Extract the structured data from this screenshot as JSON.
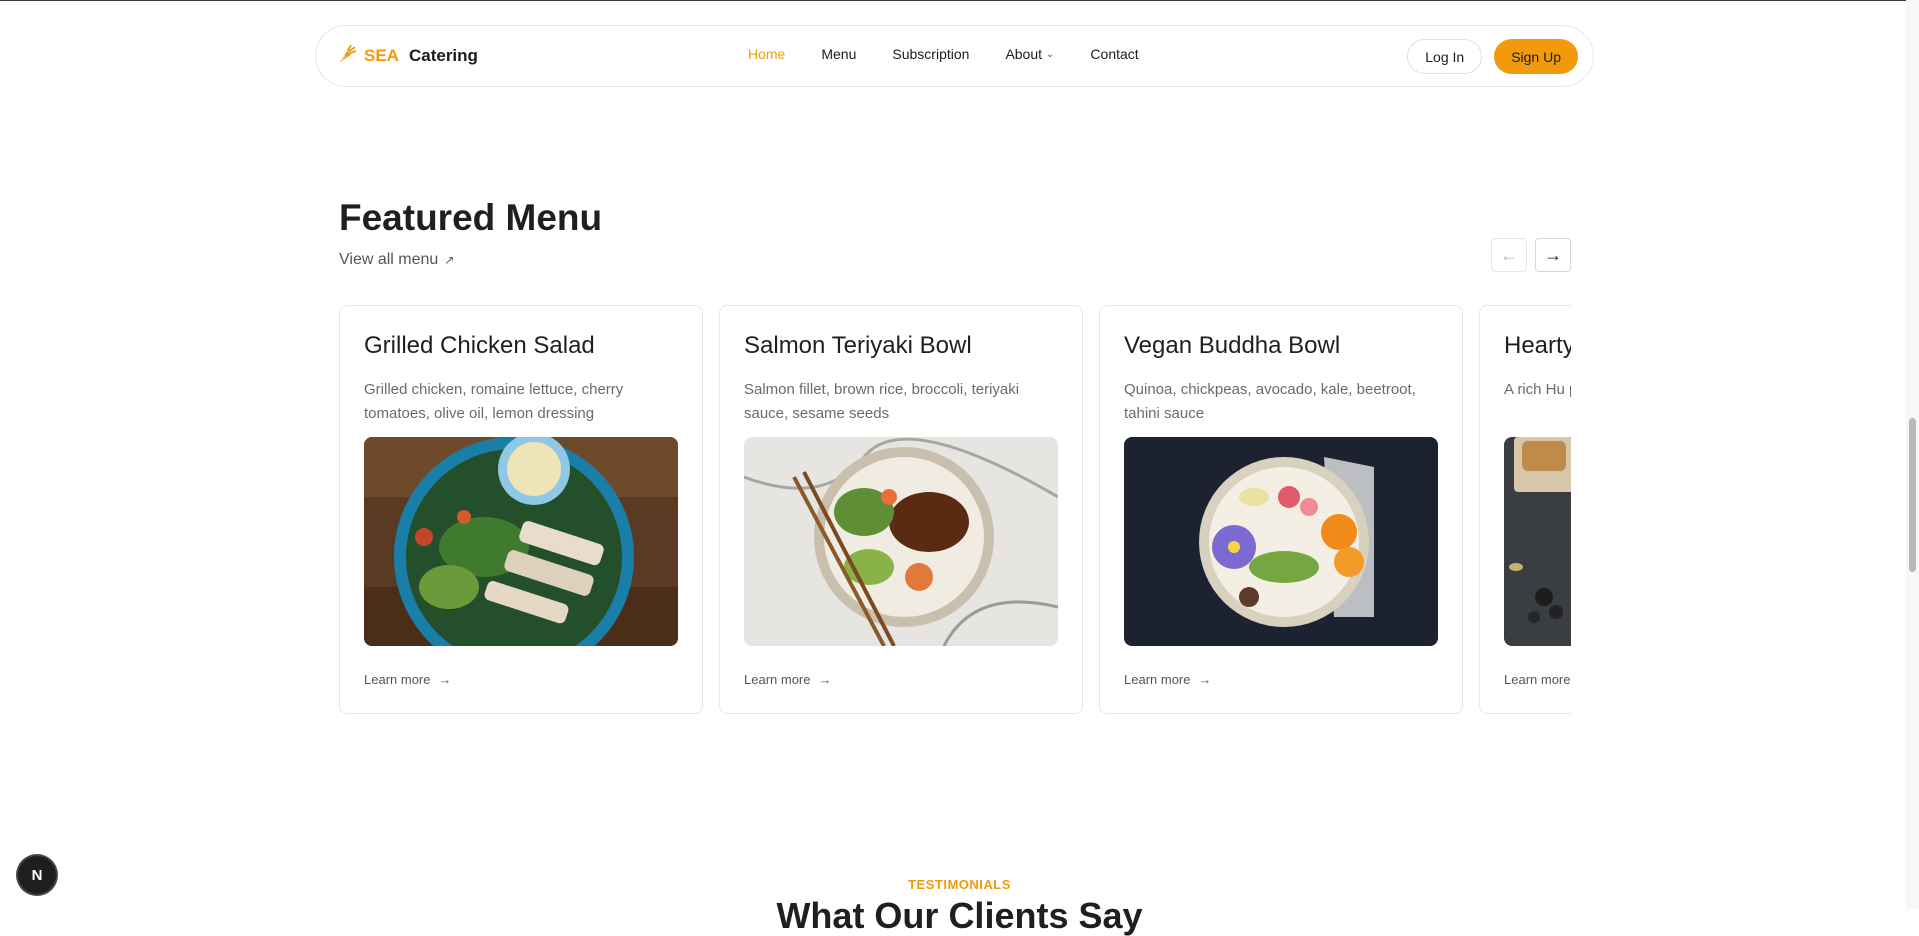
{
  "brand": {
    "accent": "SEA",
    "name": "Catering",
    "accent_color": "#f29a0b"
  },
  "nav": {
    "items": [
      {
        "label": "Home",
        "active": true
      },
      {
        "label": "Menu"
      },
      {
        "label": "Subscription"
      },
      {
        "label": "About",
        "dropdown": true
      },
      {
        "label": "Contact"
      }
    ],
    "login_label": "Log In",
    "signup_label": "Sign Up"
  },
  "featured": {
    "title": "Featured Menu",
    "view_all_label": "View all menu",
    "cards": [
      {
        "title": "Grilled Chicken Salad",
        "description": "Grilled chicken, romaine lettuce, cherry tomatoes, olive oil, lemon dressing",
        "link_label": "Learn more",
        "image_icon": "chicken-salad-photo"
      },
      {
        "title": "Salmon Teriyaki Bowl",
        "description": "Salmon fillet, brown rice, broccoli, teriyaki sauce, sesame seeds",
        "link_label": "Learn more",
        "image_icon": "salmon-bowl-photo"
      },
      {
        "title": "Vegan Buddha Bowl",
        "description": "Quinoa, chickpeas, avocado, kale, beetroot, tahini sauce",
        "link_label": "Learn more",
        "image_icon": "buddha-bowl-photo"
      },
      {
        "title": "Hearty",
        "description": "A rich Hu paprika, p",
        "link_label": "Learn more",
        "image_icon": "stew-photo"
      }
    ]
  },
  "testimonials": {
    "eyebrow": "TESTIMONIALS",
    "heading": "What Our Clients Say"
  },
  "dev_badge": {
    "letter": "N"
  }
}
